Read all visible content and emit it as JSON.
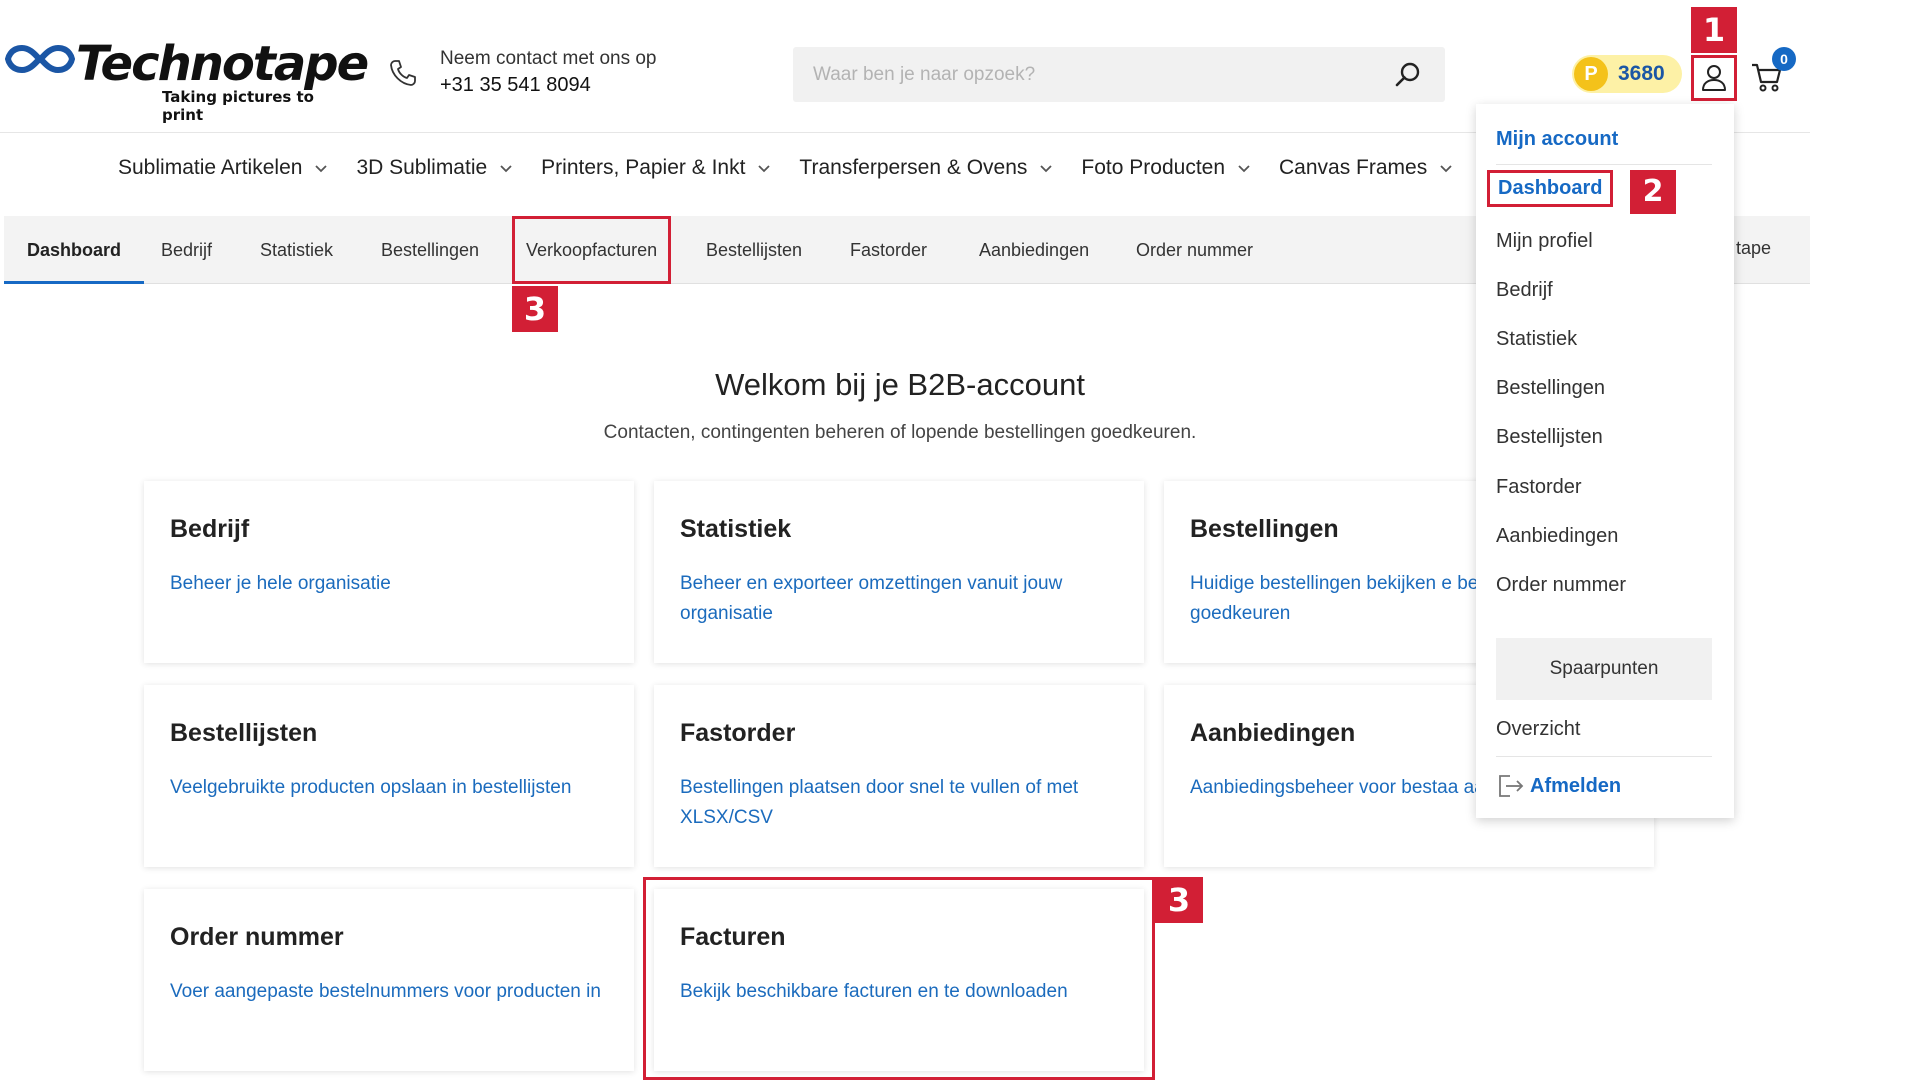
{
  "header": {
    "logo_word": "Technotape",
    "logo_tagline": "Taking pictures to print",
    "contact_label": "Neem contact met ons op",
    "contact_phone": "+31 35 541 8094",
    "search_placeholder": "Waar ben je naar opzoek?",
    "points_letter": "P",
    "points_value": "3680",
    "cart_count": "0"
  },
  "categories": [
    "Sublimatie Artikelen",
    "3D Sublimatie",
    "Printers, Papier & Inkt",
    "Transferpersen & Ovens",
    "Foto Producten",
    "Canvas Frames"
  ],
  "tabs": [
    "Dashboard",
    "Bedrijf",
    "Statistiek",
    "Bestellingen",
    "Verkoopfacturen",
    "Bestellijsten",
    "Fastorder",
    "Aanbiedingen",
    "Order nummer"
  ],
  "tab_overflow_text": "tape",
  "welcome": {
    "title": "Welkom bij je B2B-account",
    "subtitle": "Contacten, contingenten beheren of lopende bestellingen goedkeuren."
  },
  "cards": [
    {
      "title": "Bedrijf",
      "desc": "Beheer je hele organisatie"
    },
    {
      "title": "Statistiek",
      "desc": "Beheer en exporteer omzettingen vanuit jouw organisatie"
    },
    {
      "title": "Bestellingen",
      "desc": "Huidige bestellingen bekijken e bestellingen goedkeuren"
    },
    {
      "title": "Bestellijsten",
      "desc": "Veelgebruikte producten opslaan in bestellijsten"
    },
    {
      "title": "Fastorder",
      "desc": "Bestellingen plaatsen door snel te vullen of met XLSX/CSV"
    },
    {
      "title": "Aanbiedingen",
      "desc": "Aanbiedingsbeheer voor bestaa aanbiedingen"
    },
    {
      "title": "Order nummer",
      "desc": "Voer aangepaste bestelnummers voor producten in"
    },
    {
      "title": "Facturen",
      "desc": "Bekijk beschikbare facturen en te downloaden"
    }
  ],
  "dropdown": {
    "heading": "Mijn account",
    "items": [
      "Dashboard",
      "Mijn profiel",
      "Bedrijf",
      "Statistiek",
      "Bestellingen",
      "Bestellijsten",
      "Fastorder",
      "Aanbiedingen",
      "Order nummer"
    ],
    "spaarpunten": "Spaarpunten",
    "overzicht": "Overzicht",
    "logout": "Afmelden"
  },
  "markers": [
    "1",
    "2",
    "3",
    "3"
  ],
  "colors": {
    "accent_blue": "#1669c4",
    "link_blue": "#1b6bbd",
    "annotation_red": "#d21f35",
    "points_bg": "#fdf1a6",
    "coin_yellow": "#f4c21a"
  }
}
